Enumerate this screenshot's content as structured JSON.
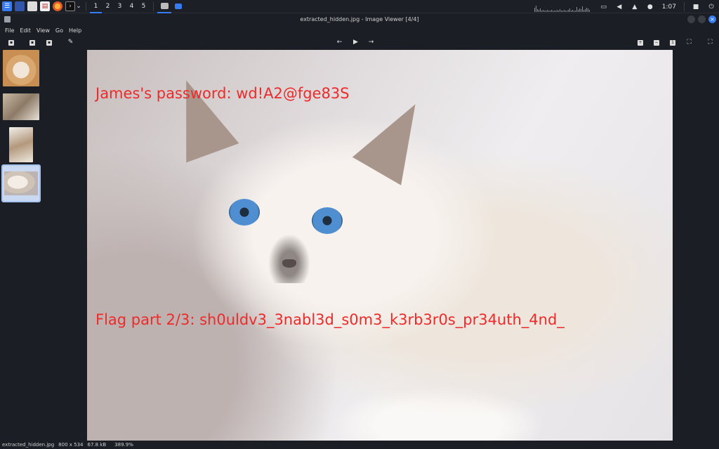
{
  "panel": {
    "workspaces": [
      "1",
      "2",
      "3",
      "4",
      "5"
    ],
    "clock": "1:07",
    "icons": [
      "kali-menu-icon",
      "desktop-icon",
      "files-icon",
      "text-editor-icon",
      "firefox-icon",
      "terminal-icon",
      "image-viewer-task-icon",
      "window-task-icon",
      "display-icon",
      "volume-icon",
      "notifications-icon",
      "power-icon",
      "lock-icon",
      "logout-icon"
    ]
  },
  "window": {
    "title": "extracted_hidden.jpg - Image Viewer [4/4]"
  },
  "menu": {
    "items": [
      "File",
      "Edit",
      "View",
      "Go",
      "Help"
    ]
  },
  "toolbar": {
    "icons": [
      "open-icon",
      "save-copy-icon",
      "delete-icon",
      "edit-icon",
      "back-arrow-icon",
      "play-icon",
      "forward-arrow-icon",
      "zoom-in-icon",
      "zoom-out-icon",
      "zoom-fit-icon",
      "zoom-100-icon",
      "fullscreen-icon"
    ]
  },
  "image_text": {
    "password": "James's password: wd!A2@fge83S",
    "flag": "Flag part 2/3: sh0uldv3_3nabl3d_s0m3_k3rb3r0s_pr34uth_4nd_"
  },
  "status": {
    "filename": "extracted_hidden.jpg",
    "dimensions": "800 x 534",
    "size": "67.8 kB",
    "zoom": "389.9%"
  },
  "colors": {
    "accent": "#367bf0",
    "overlay_text": "#ee2a2a",
    "background": "#1b1e24"
  }
}
